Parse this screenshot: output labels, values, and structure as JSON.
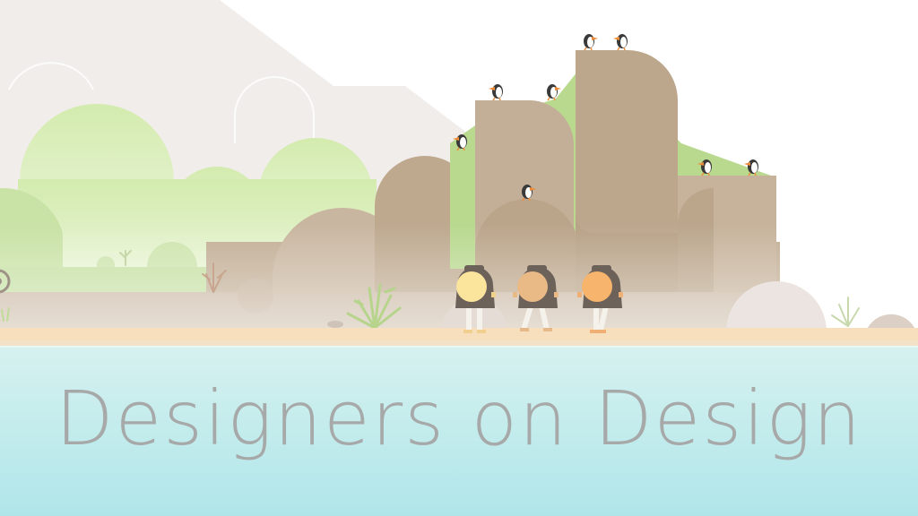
{
  "caption": {
    "title": "Designers on Design"
  },
  "colors": {
    "sky": "#ffffff",
    "mountain": "#f1edea",
    "foliage_light": "#dbeebc",
    "foliage_mid": "#c9e2a6",
    "moss": "#b9d98f",
    "cliff": "#bfa98f",
    "cliff_light": "#c9b6a0",
    "sand": "#f7dfbd",
    "water_top": "#d6f1ef",
    "water_bottom": "#b3e7ea",
    "text": "#a7a9a9"
  },
  "icons": {
    "birds": "puffin-icon",
    "characters": "hiker-character-icon"
  }
}
